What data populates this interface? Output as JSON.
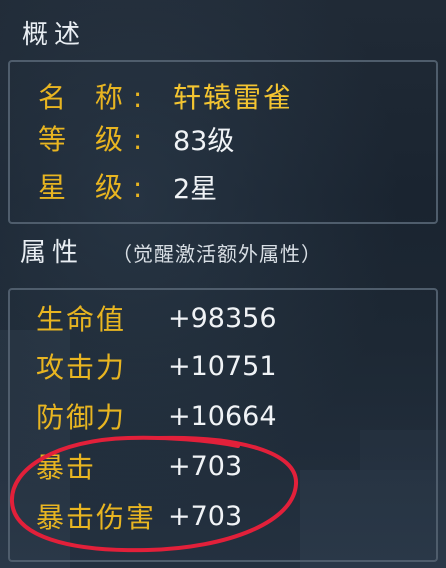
{
  "overview": {
    "title": "概述",
    "name_label": "名 称:",
    "name_value": "轩辕雷雀",
    "level_label": "等 级:",
    "level_value": "83级",
    "star_label": "星 级:",
    "star_value": "2星"
  },
  "attributes": {
    "title": "属性",
    "note": "（觉醒激活额外属性）",
    "rows": [
      {
        "label": "生命值",
        "value": "+98356"
      },
      {
        "label": "攻击力",
        "value": "+10751"
      },
      {
        "label": "防御力",
        "value": "+10664"
      },
      {
        "label": "暴击",
        "value": "+703"
      },
      {
        "label": "暴击伤害",
        "value": "+703"
      }
    ]
  },
  "colors": {
    "label_gold": "#e8b521",
    "value_white": "#f0f3f6",
    "annotation_red": "#e2203a"
  }
}
